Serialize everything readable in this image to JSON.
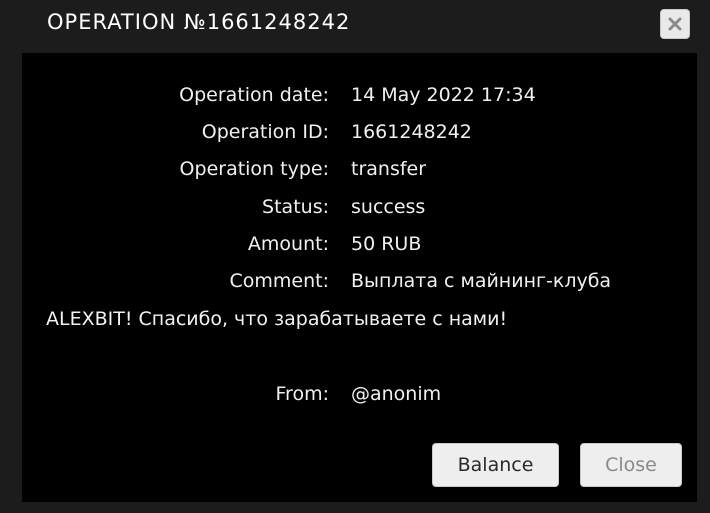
{
  "dialog": {
    "title": "OPERATION №1661248242",
    "close_icon": "close-x-icon"
  },
  "details": {
    "date_label": "Operation date:",
    "date_value": "14 May 2022 17:34",
    "id_label": "Operation ID:",
    "id_value": "1661248242",
    "type_label": "Operation type:",
    "type_value": "transfer",
    "status_label": "Status:",
    "status_value": "success",
    "amount_label": "Amount:",
    "amount_value": "50 RUB",
    "comment_label": "Comment:",
    "comment_value_line1": "Выплата с майнинг-клуба",
    "comment_value_line2": "ALEXBIT! Спасибо, что зарабатываете с нами!",
    "from_label": "From:",
    "from_value": "@anonim"
  },
  "buttons": {
    "balance_label": "Balance",
    "close_label": "Close"
  },
  "colors": {
    "content_background": "#000000",
    "frame_background": "#1c1c1c",
    "text": "#f0f0f0"
  }
}
